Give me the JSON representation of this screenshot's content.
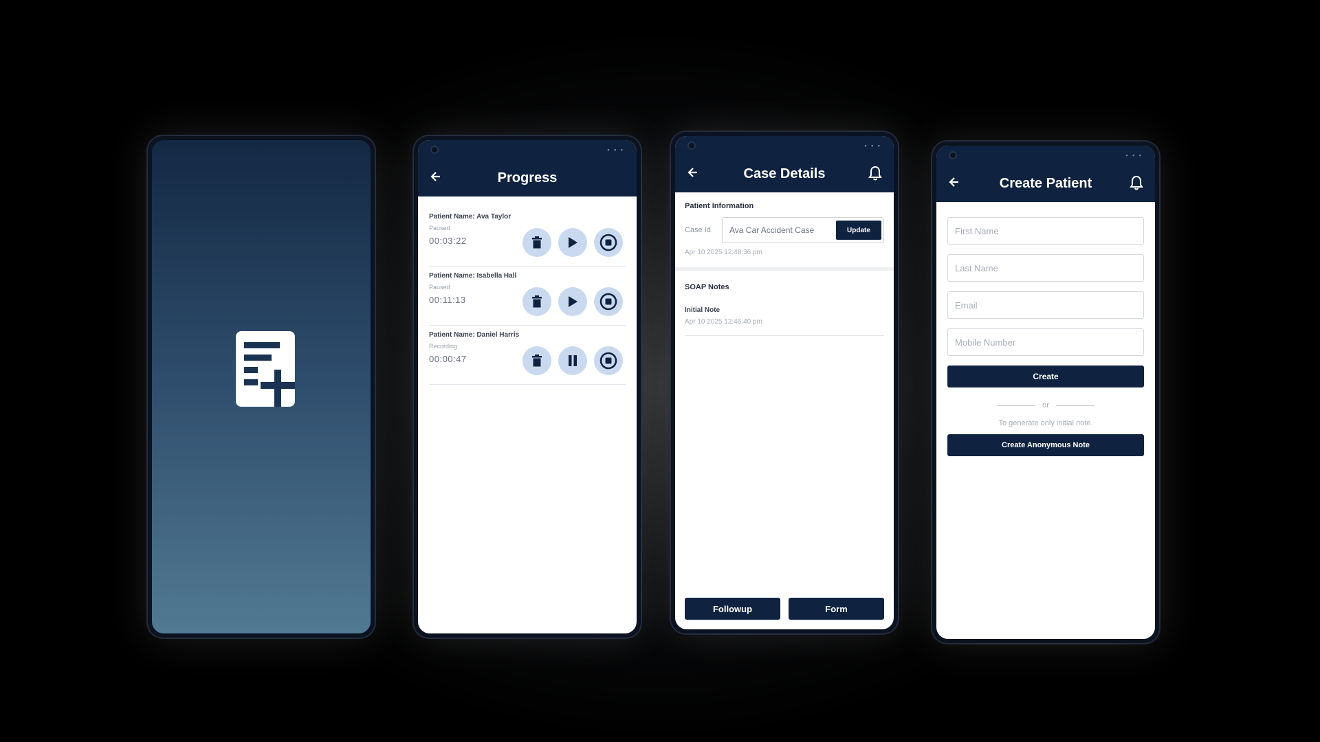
{
  "progress_screen": {
    "title": "Progress",
    "recordings": [
      {
        "name": "Patient Name: Ava Taylor",
        "status": "Paused",
        "time": "00:03:22",
        "state_icon": "play-icon"
      },
      {
        "name": "Patient Name: Isabella Hall",
        "status": "Paused",
        "time": "00:11:13",
        "state_icon": "play-icon"
      },
      {
        "name": "Patient Name: Daniel Harris",
        "status": "Recording",
        "time": "00:00:47",
        "state_icon": "pause-icon"
      }
    ]
  },
  "case_details_screen": {
    "title": "Case Details",
    "patient_info_title": "Patient Information",
    "case_id_label": "Case Id",
    "case_id_value": "Ava Car Accident Case",
    "update_label": "Update",
    "case_date": "Apr 10 2025 12:48:36 pm",
    "soap_title": "SOAP Notes",
    "note_title": "Initial Note",
    "note_date": "Apr 10 2025 12:46:40 pm",
    "followup_label": "Followup",
    "form_label": "Form"
  },
  "create_patient_screen": {
    "title": "Create Patient",
    "first_name_placeholder": "First Name",
    "last_name_placeholder": "Last Name",
    "email_placeholder": "Email",
    "mobile_placeholder": "Mobile Number",
    "create_label": "Create",
    "or_label": "or",
    "hint": "To generate only initial note.",
    "anonymous_label": "Create Anonymous Note"
  },
  "colors": {
    "primary": "#0f2340",
    "button_bg": "#c9d9ef",
    "splash_top": "#132843",
    "splash_bottom": "#527a93"
  }
}
